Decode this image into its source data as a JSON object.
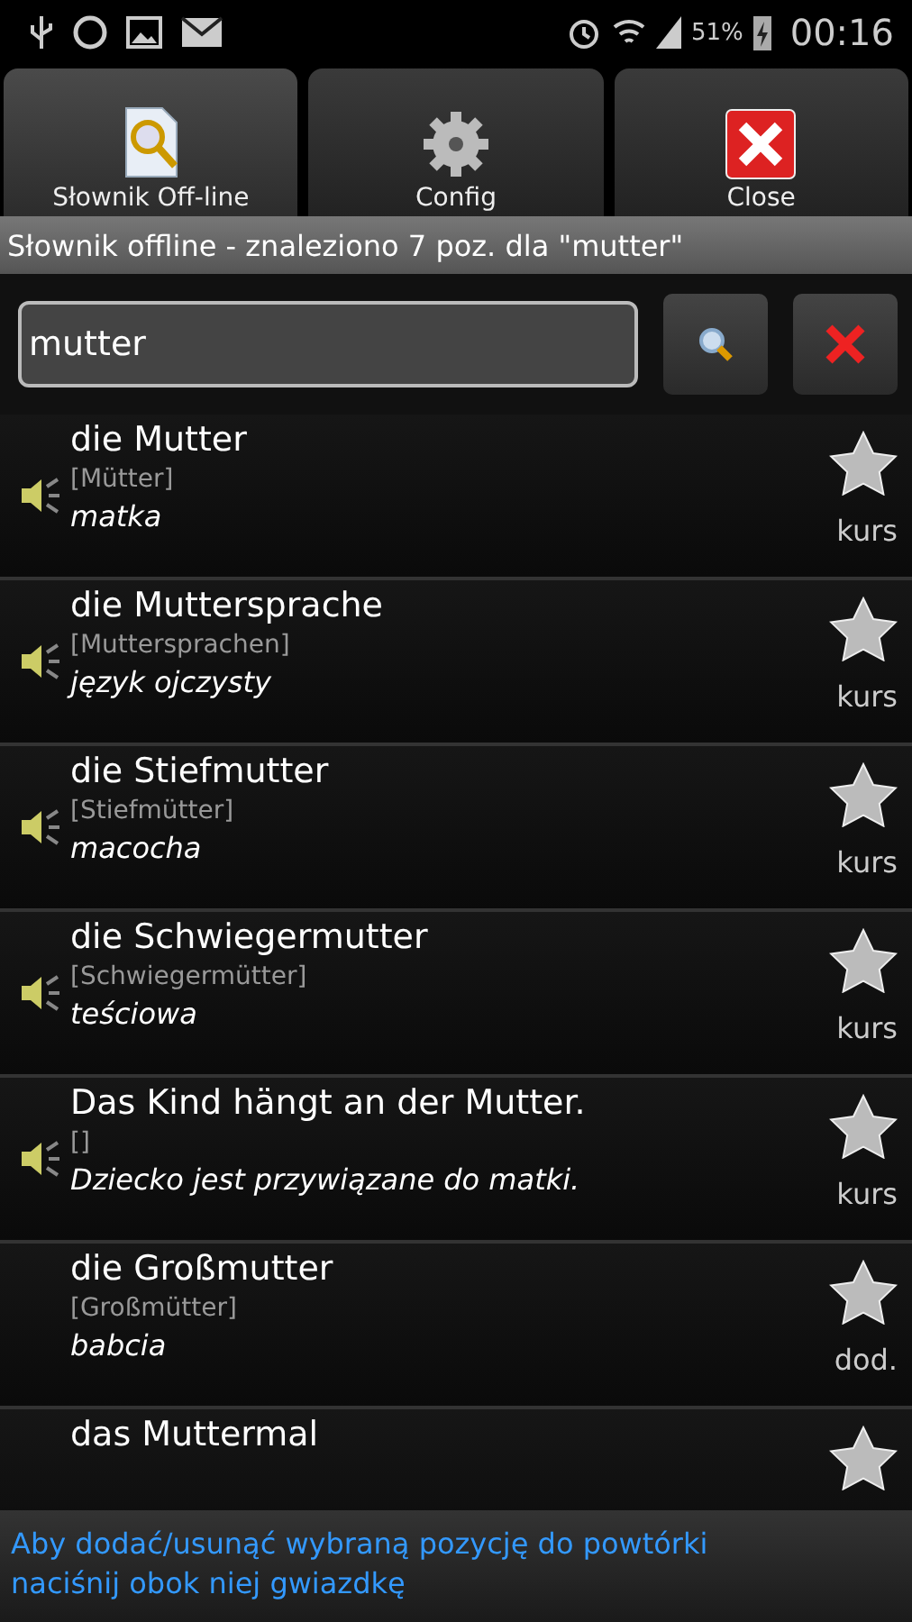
{
  "status_bar": {
    "battery": "51%",
    "time": "00:16"
  },
  "tabs": [
    {
      "label": "Słownik Off-line",
      "selected": true
    },
    {
      "label": "Config",
      "selected": false
    },
    {
      "label": "Close",
      "selected": false
    }
  ],
  "title": "Słownik offline - znaleziono 7 poz. dla  \"mutter\"",
  "search": {
    "value": "mutter"
  },
  "entries": [
    {
      "word": "die Mutter",
      "plural": "[Mütter]",
      "translation": "matka",
      "audio": true,
      "tag": "kurs"
    },
    {
      "word": "die Muttersprache",
      "plural": "[Muttersprachen]",
      "translation": "język ojczysty",
      "audio": true,
      "tag": "kurs"
    },
    {
      "word": "die Stiefmutter",
      "plural": "[Stiefmütter]",
      "translation": "macocha",
      "audio": true,
      "tag": "kurs"
    },
    {
      "word": "die Schwiegermutter",
      "plural": "[Schwiegermütter]",
      "translation": "teściowa",
      "audio": true,
      "tag": "kurs"
    },
    {
      "word": "Das Kind hängt an der Mutter.",
      "plural": "[]",
      "translation": "Dziecko jest przywiązane do matki.",
      "audio": true,
      "tag": "kurs"
    },
    {
      "word": "die Großmutter",
      "plural": "[Großmütter]",
      "translation": "babcia",
      "audio": false,
      "tag": "dod."
    },
    {
      "word": "das Muttermal",
      "audio": false
    }
  ],
  "hint": "Aby dodać/usunąć wybraną pozycję do powtórki naciśnij obok niej gwiazdkę"
}
